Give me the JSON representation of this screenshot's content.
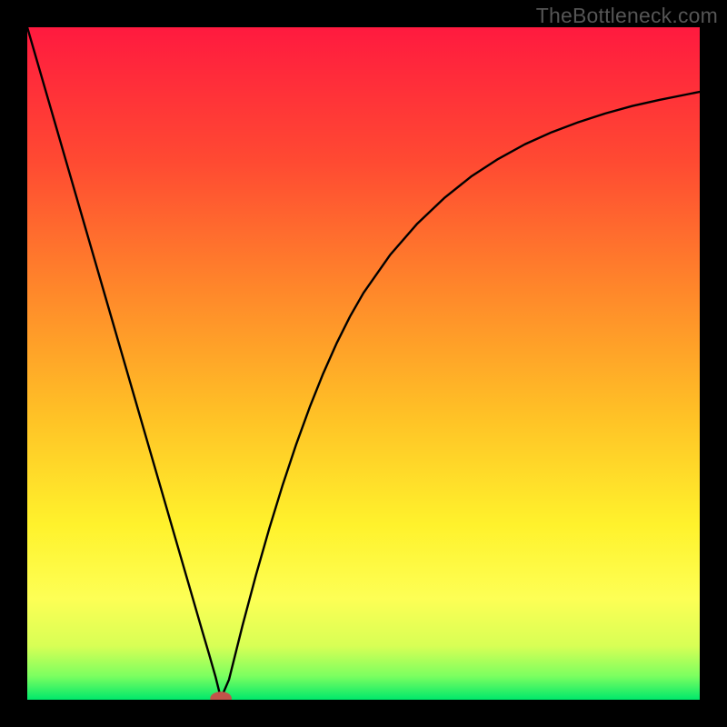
{
  "watermark": "TheBottleneck.com",
  "chart_data": {
    "type": "line",
    "title": "",
    "xlabel": "",
    "ylabel": "",
    "xlim": [
      0,
      100
    ],
    "ylim": [
      0,
      100
    ],
    "grid": false,
    "legend": false,
    "gradient_stops": [
      {
        "offset": 0.0,
        "color": "#ff1a3f"
      },
      {
        "offset": 0.2,
        "color": "#ff4a32"
      },
      {
        "offset": 0.4,
        "color": "#ff8a2a"
      },
      {
        "offset": 0.58,
        "color": "#ffc226"
      },
      {
        "offset": 0.74,
        "color": "#fff22c"
      },
      {
        "offset": 0.85,
        "color": "#fdff55"
      },
      {
        "offset": 0.92,
        "color": "#d8ff55"
      },
      {
        "offset": 0.965,
        "color": "#7bff60"
      },
      {
        "offset": 1.0,
        "color": "#00e86b"
      }
    ],
    "series": [
      {
        "name": "curve",
        "x": [
          0.0,
          2,
          4,
          6,
          8,
          10,
          12,
          14,
          16,
          18,
          20,
          22,
          24,
          26,
          27,
          28,
          28.8,
          30,
          32,
          34,
          36,
          38,
          40,
          42,
          44,
          46,
          48,
          50,
          54,
          58,
          62,
          66,
          70,
          74,
          78,
          82,
          86,
          90,
          94,
          98,
          100
        ],
        "y": [
          100,
          93.1,
          86.2,
          79.3,
          72.4,
          65.5,
          58.6,
          51.7,
          44.8,
          37.9,
          31.0,
          24.1,
          17.2,
          10.3,
          6.9,
          3.4,
          0.2,
          3.0,
          11.0,
          18.5,
          25.5,
          32.0,
          38.0,
          43.5,
          48.5,
          53.0,
          57.0,
          60.5,
          66.2,
          70.8,
          74.6,
          77.8,
          80.4,
          82.6,
          84.4,
          85.9,
          87.2,
          88.3,
          89.2,
          90.0,
          90.4
        ]
      }
    ],
    "marker": {
      "x": 28.8,
      "y": 0.2,
      "rx": 1.6,
      "ry": 1.0,
      "color": "#c1544a"
    }
  }
}
